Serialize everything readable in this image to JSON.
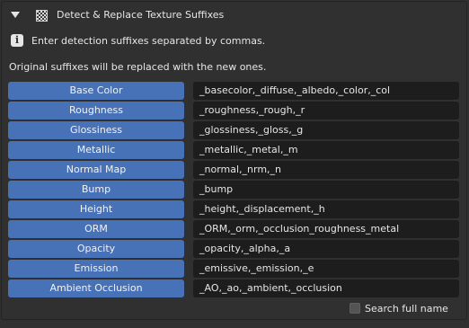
{
  "panel": {
    "title": "Detect & Replace Texture Suffixes",
    "title_icon": "checker-texture-icon",
    "collapse_icon": "triangle-down-icon"
  },
  "info": {
    "icon": "info-icon",
    "icon_glyph": "i",
    "text": "Enter detection suffixes separated by commas."
  },
  "note": "Original suffixes will be replaced with the new ones.",
  "rows": [
    {
      "label": "Base Color",
      "value": "_basecolor,_diffuse,_albedo,_color,_col"
    },
    {
      "label": "Roughness",
      "value": "_roughness,_rough,_r"
    },
    {
      "label": "Glossiness",
      "value": "_glossiness,_gloss,_g"
    },
    {
      "label": "Metallic",
      "value": "_metallic,_metal,_m"
    },
    {
      "label": "Normal Map",
      "value": "_normal,_nrm,_n"
    },
    {
      "label": "Bump",
      "value": "_bump"
    },
    {
      "label": "Height",
      "value": "_height,_displacement,_h"
    },
    {
      "label": "ORM",
      "value": "_ORM,_orm,_occlusion_roughness_metal"
    },
    {
      "label": "Opacity",
      "value": "_opacity,_alpha,_a"
    },
    {
      "label": "Emission",
      "value": "_emissive,_emission,_e"
    },
    {
      "label": "Ambient Occlusion",
      "value": "_AO,_ao,_ambient,_occlusion"
    }
  ],
  "search_full_name": {
    "label": "Search full name",
    "checked": false
  },
  "colors": {
    "panel_bg": "#303030",
    "button_blue": "#4872b8",
    "field_bg": "#1d1d1d",
    "text": "#e6e6e6"
  }
}
